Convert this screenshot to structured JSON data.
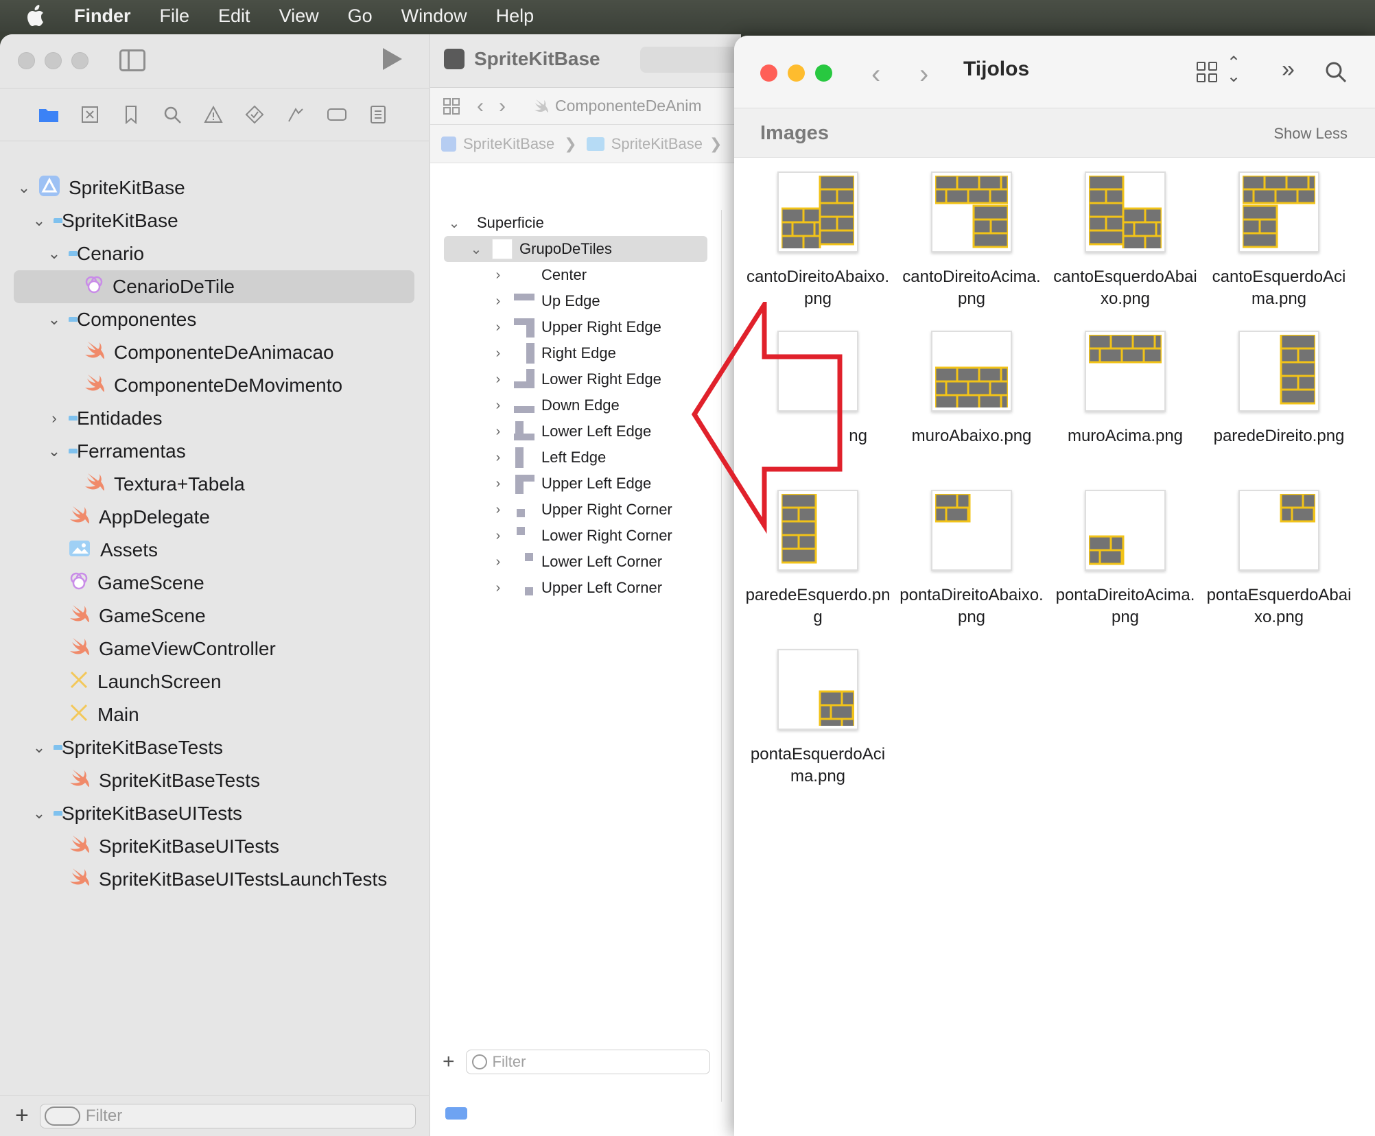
{
  "menubar": {
    "items": [
      "Finder",
      "File",
      "Edit",
      "View",
      "Go",
      "Window",
      "Help"
    ]
  },
  "xcode": {
    "project_title": "SpriteKitBase",
    "jumpbar_file": "ComponenteDeAnim",
    "breadcrumbs": [
      "SpriteKitBase",
      "SpriteKitBase"
    ],
    "navigator_filter_placeholder": "Filter",
    "outline_filter_placeholder": "Filter",
    "tree": [
      {
        "label": "SpriteKitBase",
        "level": 0,
        "icon": "project-icon",
        "expanded": true
      },
      {
        "label": "SpriteKitBase",
        "level": 1,
        "icon": "folder-icon",
        "expanded": true
      },
      {
        "label": "Cenario",
        "level": 2,
        "icon": "folder-icon",
        "expanded": true
      },
      {
        "label": "CenarioDeTile",
        "level": 3,
        "icon": "tileset-icon",
        "selected": true
      },
      {
        "label": "Componentes",
        "level": 2,
        "icon": "folder-icon",
        "expanded": true
      },
      {
        "label": "ComponenteDeAnimacao",
        "level": 3,
        "icon": "swift-icon"
      },
      {
        "label": "ComponenteDeMovimento",
        "level": 3,
        "icon": "swift-icon"
      },
      {
        "label": "Entidades",
        "level": 2,
        "icon": "folder-icon",
        "expanded": false
      },
      {
        "label": "Ferramentas",
        "level": 2,
        "icon": "folder-icon",
        "expanded": true
      },
      {
        "label": "Textura+Tabela",
        "level": 3,
        "icon": "swift-icon"
      },
      {
        "label": "AppDelegate",
        "level": 2,
        "icon": "swift-icon"
      },
      {
        "label": "Assets",
        "level": 2,
        "icon": "assets-icon"
      },
      {
        "label": "GameScene",
        "level": 2,
        "icon": "scene-icon"
      },
      {
        "label": "GameScene",
        "level": 2,
        "icon": "swift-icon"
      },
      {
        "label": "GameViewController",
        "level": 2,
        "icon": "swift-icon"
      },
      {
        "label": "LaunchScreen",
        "level": 2,
        "icon": "storyboard-icon"
      },
      {
        "label": "Main",
        "level": 2,
        "icon": "storyboard-icon"
      },
      {
        "label": "SpriteKitBaseTests",
        "level": 1,
        "icon": "folder-icon",
        "expanded": true
      },
      {
        "label": "SpriteKitBaseTests",
        "level": 2,
        "icon": "swift-icon"
      },
      {
        "label": "SpriteKitBaseUITests",
        "level": 1,
        "icon": "folder-icon",
        "expanded": true
      },
      {
        "label": "SpriteKitBaseUITests",
        "level": 2,
        "icon": "swift-icon"
      },
      {
        "label": "SpriteKitBaseUITestsLaunchTests",
        "level": 2,
        "icon": "swift-icon"
      }
    ],
    "outline": [
      {
        "label": "Superficie",
        "level": 0,
        "expanded": true
      },
      {
        "label": "GrupoDeTiles",
        "level": 1,
        "expanded": true,
        "selected": true
      },
      {
        "label": "Center",
        "level": 2
      },
      {
        "label": "Up Edge",
        "level": 2
      },
      {
        "label": "Upper Right Edge",
        "level": 2
      },
      {
        "label": "Right Edge",
        "level": 2
      },
      {
        "label": "Lower Right Edge",
        "level": 2
      },
      {
        "label": "Down Edge",
        "level": 2
      },
      {
        "label": "Lower Left Edge",
        "level": 2
      },
      {
        "label": "Left Edge",
        "level": 2
      },
      {
        "label": "Upper Left Edge",
        "level": 2
      },
      {
        "label": "Upper Right Corner",
        "level": 2
      },
      {
        "label": "Lower Right Corner",
        "level": 2
      },
      {
        "label": "Lower Left Corner",
        "level": 2
      },
      {
        "label": "Upper Left Corner",
        "level": 2
      }
    ]
  },
  "finder": {
    "title": "Tijolos",
    "section_label": "Images",
    "show_less": "Show Less",
    "files": [
      {
        "name": "cantoDireitoAbaixo.png",
        "tile": "canto-dir-abaixo"
      },
      {
        "name": "cantoDireitoAcima.png",
        "tile": "canto-dir-acima"
      },
      {
        "name": "cantoEsquerdoAbaixo.png",
        "tile": "canto-esq-abaixo"
      },
      {
        "name": "cantoEsquerdoAcima.png",
        "tile": "canto-esq-acima"
      },
      {
        "name": "ng",
        "tile": "hidden"
      },
      {
        "name": "muroAbaixo.png",
        "tile": "muro-abaixo"
      },
      {
        "name": "muroAcima.png",
        "tile": "muro-acima"
      },
      {
        "name": "paredeDireito.png",
        "tile": "parede-dir"
      },
      {
        "name": "paredeEsquerdo.png",
        "tile": "parede-esq"
      },
      {
        "name": "pontaDireitoAbaixo.png",
        "tile": "ponta-dir-abaixo"
      },
      {
        "name": "pontaDireitoAcima.png",
        "tile": "ponta-dir-acima"
      },
      {
        "name": "pontaEsquerdoAbaixo.png",
        "tile": "ponta-esq-abaixo"
      },
      {
        "name": "pontaEsquerdoAcima.png",
        "tile": "ponta-esq-acima"
      }
    ]
  },
  "colors": {
    "brick": "#737373",
    "mortar": "#f2c318",
    "arrow": "#e0212b",
    "folder": "#7fc1ee",
    "swift": "#f08a6a"
  }
}
